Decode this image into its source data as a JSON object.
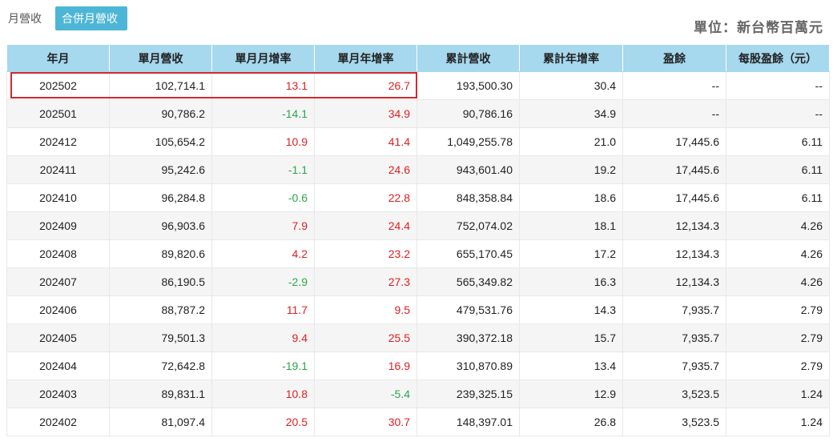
{
  "tabs": [
    {
      "label": "月營收",
      "active": false
    },
    {
      "label": "合併月營收",
      "active": true
    }
  ],
  "unit_label": "單位：新台幣百萬元",
  "table": {
    "columns": [
      "年月",
      "單月營收",
      "單月月增率",
      "單月年增率",
      "累計營收",
      "累計年增率",
      "盈餘",
      "每股盈餘（元）"
    ],
    "rows": [
      [
        "202502",
        "102,714.1",
        "13.1",
        "26.7",
        "193,500.30",
        "30.4",
        "--",
        "--"
      ],
      [
        "202501",
        "90,786.2",
        "-14.1",
        "34.9",
        "90,786.16",
        "34.9",
        "--",
        "--"
      ],
      [
        "202412",
        "105,654.2",
        "10.9",
        "41.4",
        "1,049,255.78",
        "21.0",
        "17,445.6",
        "6.11"
      ],
      [
        "202411",
        "95,242.6",
        "-1.1",
        "24.6",
        "943,601.40",
        "19.2",
        "17,445.6",
        "6.11"
      ],
      [
        "202410",
        "96,284.8",
        "-0.6",
        "22.8",
        "848,358.84",
        "18.6",
        "17,445.6",
        "6.11"
      ],
      [
        "202409",
        "96,903.6",
        "7.9",
        "24.4",
        "752,074.02",
        "18.1",
        "12,134.3",
        "4.26"
      ],
      [
        "202408",
        "89,820.6",
        "4.2",
        "23.2",
        "655,170.45",
        "17.2",
        "12,134.3",
        "4.26"
      ],
      [
        "202407",
        "86,190.5",
        "-2.9",
        "27.3",
        "565,349.82",
        "16.3",
        "12,134.3",
        "4.26"
      ],
      [
        "202406",
        "88,787.2",
        "11.7",
        "9.5",
        "479,531.76",
        "14.3",
        "7,935.7",
        "2.79"
      ],
      [
        "202405",
        "79,501.3",
        "9.4",
        "25.5",
        "390,372.18",
        "15.7",
        "7,935.7",
        "2.79"
      ],
      [
        "202404",
        "72,642.8",
        "-19.1",
        "16.9",
        "310,870.89",
        "13.4",
        "7,935.7",
        "2.79"
      ],
      [
        "202403",
        "89,831.1",
        "10.8",
        "-5.4",
        "239,325.15",
        "12.9",
        "3,523.5",
        "1.24"
      ],
      [
        "202402",
        "81,097.4",
        "20.5",
        "30.7",
        "148,397.01",
        "26.8",
        "3,523.5",
        "1.24"
      ]
    ]
  },
  "colors": {
    "header_bg": "#a6d8ee",
    "active_tab_bg": "#4db6d6",
    "positive": "#e02020",
    "negative": "#2aa84a",
    "highlight_border": "#d02a30"
  }
}
